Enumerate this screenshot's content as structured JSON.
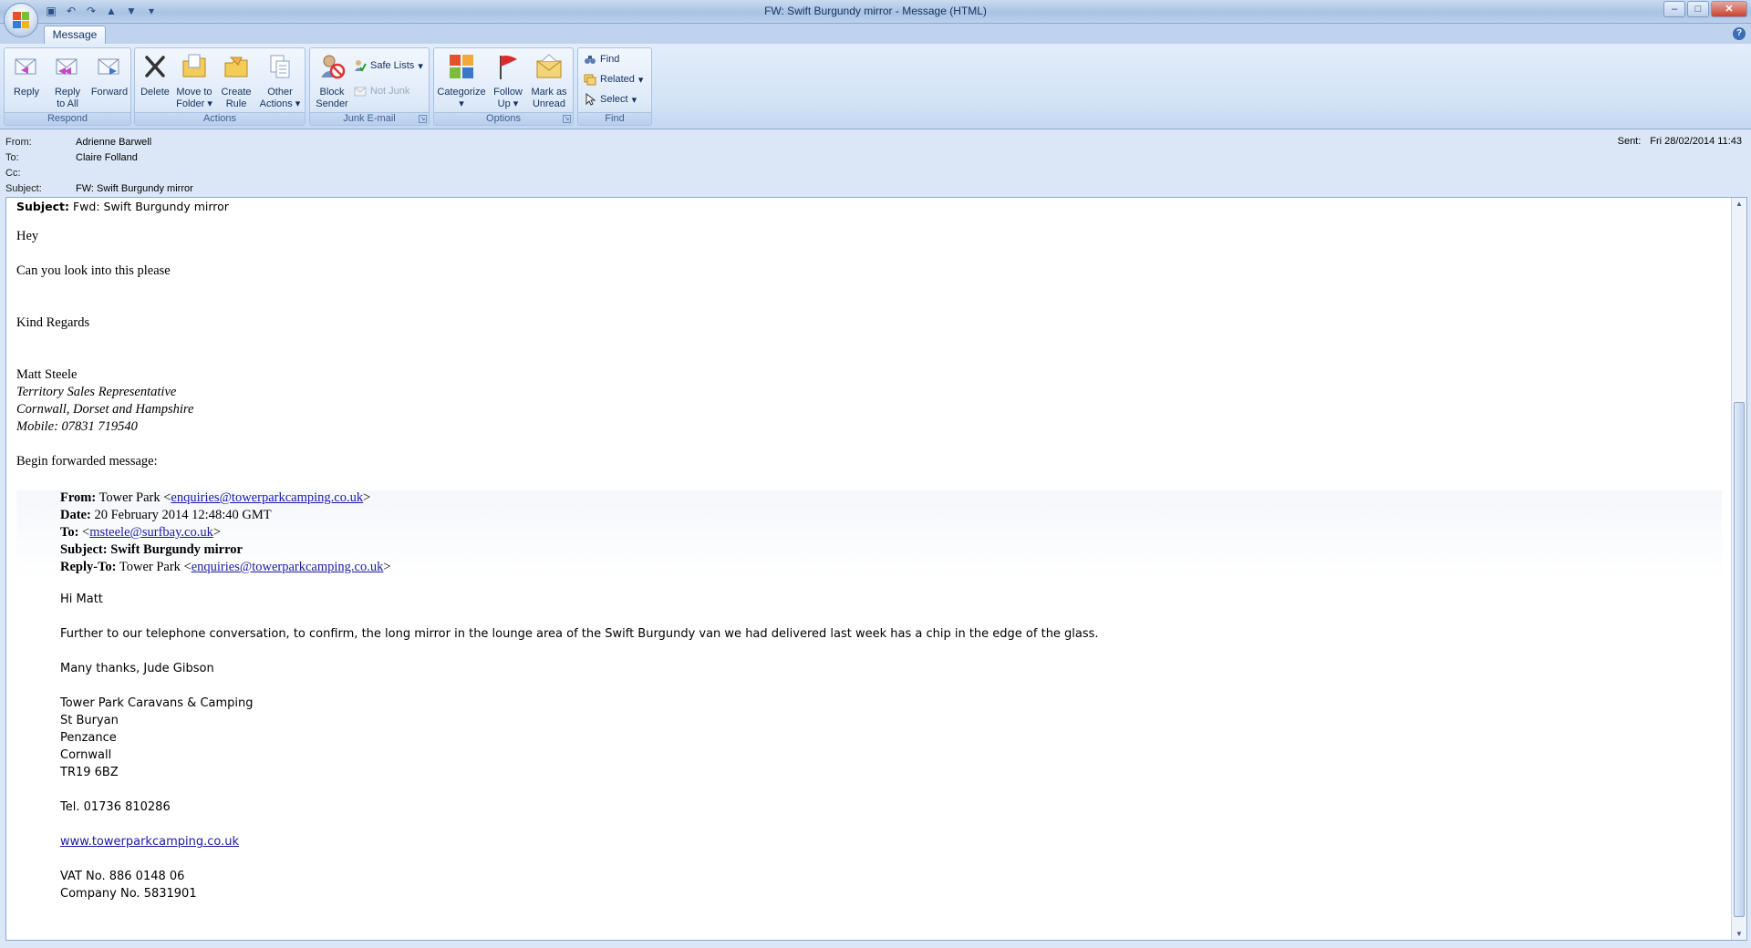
{
  "window": {
    "title": "FW: Swift Burgundy mirror - Message (HTML)",
    "controls": [
      "–",
      "□",
      "✕"
    ]
  },
  "tabs": {
    "active": "Message"
  },
  "ribbon": {
    "respond": {
      "label": "Respond",
      "reply": "Reply",
      "reply_all_1": "Reply",
      "reply_all_2": "to All",
      "forward": "Forward"
    },
    "actions": {
      "label": "Actions",
      "delete": "Delete",
      "move_1": "Move to",
      "move_2": "Folder",
      "rule_1": "Create",
      "rule_2": "Rule",
      "other_1": "Other",
      "other_2": "Actions"
    },
    "junk": {
      "label": "Junk E-mail",
      "block_1": "Block",
      "block_2": "Sender",
      "safe_lists": "Safe Lists",
      "not_junk": "Not Junk"
    },
    "options": {
      "label": "Options",
      "categorize": "Categorize",
      "follow_1": "Follow",
      "follow_2": "Up",
      "mark_1": "Mark as",
      "mark_2": "Unread"
    },
    "find": {
      "label": "Find",
      "find": "Find",
      "related": "Related",
      "select": "Select"
    }
  },
  "header": {
    "from_label": "From:",
    "from": "Adrienne Barwell",
    "to_label": "To:",
    "to": "Claire Folland",
    "cc_label": "Cc:",
    "cc": "",
    "subject_label": "Subject:",
    "subject": "FW: Swift Burgundy mirror",
    "sent_label": "Sent:",
    "sent": "Fri 28/02/2014 11:43"
  },
  "body": {
    "subject_label": "Subject:",
    "subject": "Fwd: Swift Burgundy mirror",
    "greeting": "Hey",
    "request": "Can you look into this please",
    "regards": "Kind Regards",
    "sig_name": "Matt Steele",
    "sig_title": "Territory Sales Representative",
    "sig_area": "Cornwall, Dorset and Hampshire",
    "sig_mobile": "Mobile: 07831 719540",
    "begin_fwd": "Begin forwarded message:",
    "fwd": {
      "from_label": "From:",
      "from_name": "Tower Park <",
      "from_email": "enquiries@towerparkcamping.co.uk",
      "from_close": ">",
      "date_label": "Date:",
      "date": "20 February 2014 12:48:40 GMT",
      "to_label": "To:",
      "to_open": "<",
      "to_email": "msteele@surfbay.co.uk",
      "to_close": ">",
      "subject_label": "Subject:",
      "subject": "Swift Burgundy mirror",
      "replyto_label": "Reply-To:",
      "replyto_name": "Tower Park <",
      "replyto_email": "enquiries@towerparkcamping.co.uk",
      "replyto_close": ">",
      "hi": "Hi Matt",
      "para": "Further to our telephone conversation, to confirm, the long mirror in the lounge area of the Swift Burgundy van we had delivered last week has a chip in the edge of the glass.",
      "thanks": "Many thanks, Jude Gibson",
      "addr1": "Tower Park Caravans & Camping",
      "addr2": "St Buryan",
      "addr3": "Penzance",
      "addr4": "Cornwall",
      "addr5": "TR19 6BZ",
      "tel": "Tel. 01736 810286",
      "web": "www.towerparkcamping.co.uk",
      "vat": "VAT No. 886 0148 06",
      "company": "Company No. 5831901"
    }
  }
}
